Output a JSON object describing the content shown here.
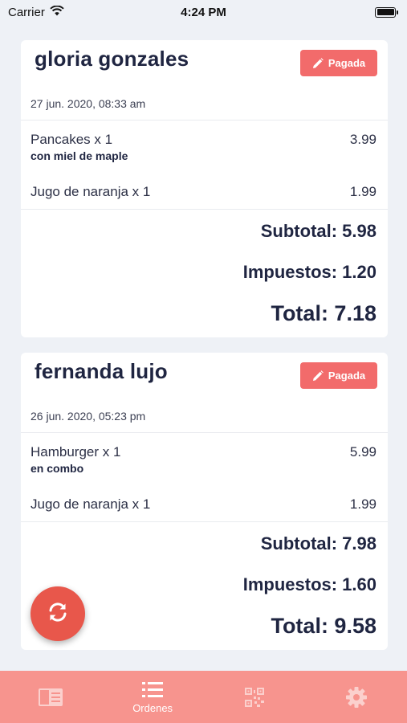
{
  "status_bar": {
    "carrier": "Carrier",
    "time": "4:24 PM"
  },
  "orders": [
    {
      "customer": "gloria gonzales",
      "status_label": "Pagada",
      "date": "27 jun. 2020, 08:33 am",
      "items": [
        {
          "name": "Pancakes x 1",
          "note": "con miel de maple",
          "price": "3.99"
        },
        {
          "name": "Jugo de naranja x 1",
          "price": "1.99"
        }
      ],
      "subtotal": "Subtotal: 5.98",
      "taxes": "Impuestos: 1.20",
      "total": "Total: 7.18"
    },
    {
      "customer": "fernanda lujo",
      "status_label": "Pagada",
      "date": "26 jun. 2020, 05:23 pm",
      "items": [
        {
          "name": "Hamburger x 1",
          "note": "en combo",
          "price": "5.99"
        },
        {
          "name": "Jugo de naranja x 1",
          "price": "1.99"
        }
      ],
      "subtotal": "Subtotal: 7.98",
      "taxes": "Impuestos: 1.60",
      "total": "Total: 9.58"
    }
  ],
  "fab": {
    "icon": "refresh-icon"
  },
  "tab_bar": {
    "tabs": [
      {
        "icon": "menu-book-icon",
        "label": ""
      },
      {
        "icon": "list-icon",
        "label": "Ordenes",
        "active": true
      },
      {
        "icon": "qr-code-icon",
        "label": ""
      },
      {
        "icon": "gear-icon",
        "label": ""
      }
    ]
  },
  "colors": {
    "accent": "#f26b6b",
    "tab_bar": "#f7948e",
    "fab": "#e8574b",
    "text_dark": "#1f2541",
    "background": "#eef1f6"
  }
}
